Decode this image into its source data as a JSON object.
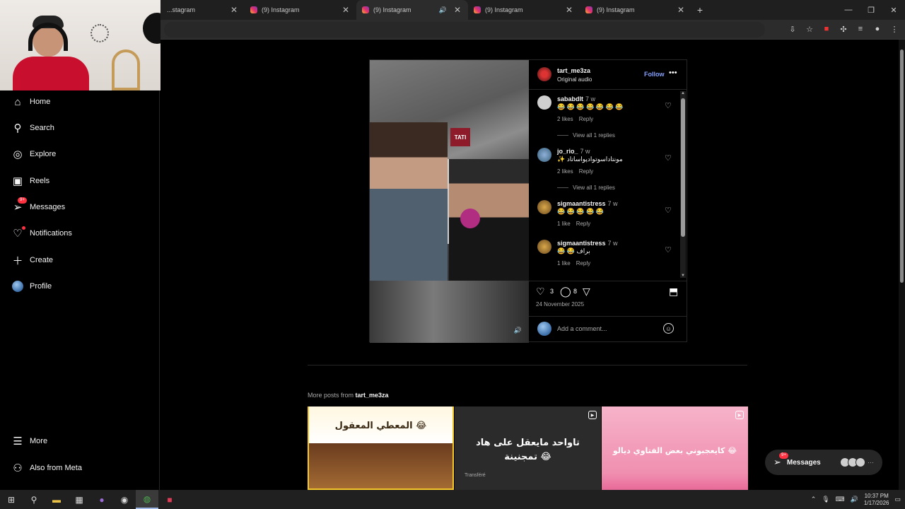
{
  "browser": {
    "tabs": [
      {
        "title": "...stagram",
        "active": false
      },
      {
        "title": "(9) Instagram",
        "active": false
      },
      {
        "title": "(9) Instagram",
        "active": true
      },
      {
        "title": "(9) Instagram",
        "active": false
      },
      {
        "title": "(9) Instagram",
        "active": false
      }
    ],
    "new_tab": "+",
    "win": {
      "min": "—",
      "restore": "❐",
      "close": "✕"
    }
  },
  "sidebar": {
    "items": [
      {
        "label": "Home",
        "icon": "home-icon"
      },
      {
        "label": "Search",
        "icon": "search-icon"
      },
      {
        "label": "Explore",
        "icon": "explore-icon"
      },
      {
        "label": "Reels",
        "icon": "reels-icon"
      },
      {
        "label": "Messages",
        "icon": "messages-icon",
        "badge": "9+"
      },
      {
        "label": "Notifications",
        "icon": "heart-icon"
      },
      {
        "label": "Create",
        "icon": "plus-icon"
      },
      {
        "label": "Profile",
        "icon": "avatar"
      }
    ],
    "bottom": [
      {
        "label": "More",
        "icon": "menu-icon"
      },
      {
        "label": "Also from Meta",
        "icon": "meta-icon"
      }
    ]
  },
  "post": {
    "username": "tart_me3za",
    "audio": "Original audio",
    "follow": "Follow",
    "more": "•••",
    "video_sign": "TATI",
    "comments": [
      {
        "user": "sababdlt",
        "time": "7 w",
        "text": "😂 😂 😂 😂 😂 😂 😂",
        "likes": "2 likes",
        "reply": "Reply",
        "view_replies": "View all 1 replies"
      },
      {
        "user": "jo_rio_",
        "time": "7 w",
        "text": "✨ مونتاداسوتوادپواساتاد",
        "likes": "2 likes",
        "reply": "Reply",
        "view_replies": "View all 1 replies"
      },
      {
        "user": "sigmaantistress",
        "time": "7 w",
        "text": "😂 😂 😂 😂 😂",
        "likes": "1 like",
        "reply": "Reply"
      },
      {
        "user": "sigmaantistress",
        "time": "7 w",
        "text": "😂 😂 براف",
        "likes": "1 like",
        "reply": "Reply"
      }
    ],
    "like_count": "3",
    "comment_count": "8",
    "date": "24 November 2025",
    "add_comment_placeholder": "Add a comment..."
  },
  "more_posts": {
    "prefix": "More posts from ",
    "user": "tart_me3za",
    "thumbs": [
      {
        "caption": "المعطي المعقول 😂"
      },
      {
        "caption": "تاواحد مايعقل على هاد تمجنينة 😂"
      },
      {
        "caption": "كايعجبوني بعض الفتاوي ديالو 😂"
      }
    ],
    "thumb2_sub": "Transféré"
  },
  "messages_pill": {
    "label": "Messages",
    "badge": "9+"
  },
  "taskbar": {
    "time": "10:37 PM",
    "date": "1/17/2026"
  },
  "colors": {
    "accent": "#85a1ff",
    "badge": "#ff3040",
    "bg": "#000000"
  }
}
